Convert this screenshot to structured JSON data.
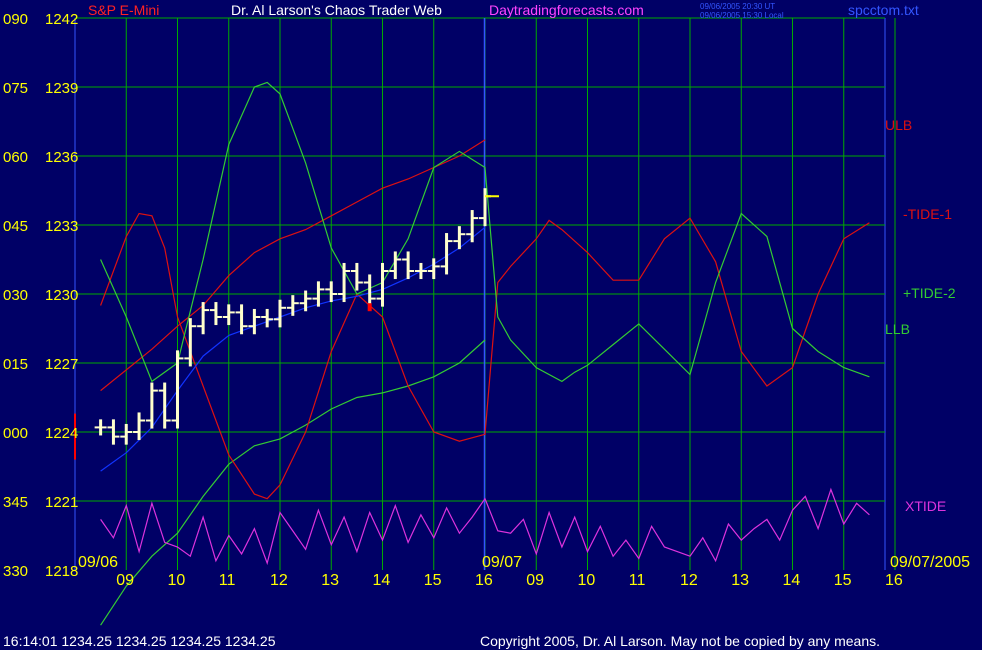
{
  "header": {
    "title_left": "S&P E-Mini",
    "title_center": "Dr. Al Larson's Chaos Trader Web",
    "site": "Daytradingforecasts.com",
    "timestamp_utc": "09/06/2005 20:30 UT",
    "timestamp_local": "09/06/2005 15:30 Local",
    "file_name": "spcctom.txt"
  },
  "footer": {
    "status": "16:14:01  1234.25 1234.25 1234.25 1234.25",
    "copyright": "Copyright 2005, Dr. Al Larson. May not be copied by any means."
  },
  "colors": {
    "background": "#000066",
    "grid": "#00aa00",
    "price_bars": "#ffffcc",
    "up_tick": "#ff0000",
    "ulb": "#dd1111",
    "llb": "#33cc33",
    "tide1": "#dd1111",
    "tide2": "#33cc33",
    "xtide": "#dd33dd",
    "mean": "#1133ff",
    "date_labels": "#ffff00",
    "hour_labels": "#ffff00",
    "osc_labels": "#ffff00",
    "price_labels": "#ffff00"
  },
  "chart_data": {
    "type": "line",
    "title": "Dr. Al Larson's Chaos Trader Web",
    "instrument": "S&P E-Mini",
    "date_labels": [
      "09/06",
      "09/07",
      "09/07/2005"
    ],
    "x_hours": [
      "09",
      "10",
      "11",
      "12",
      "13",
      "14",
      "15",
      "16",
      "09",
      "10",
      "11",
      "12",
      "13",
      "14",
      "15",
      "16"
    ],
    "y_price_ticks": [
      1218,
      1221,
      1224,
      1227,
      1230,
      1233,
      1236,
      1239,
      1242
    ],
    "y_price_labels": [
      "1218",
      "1221",
      "1224",
      "1227",
      "1230",
      "1233",
      "1236",
      "1239",
      "1242"
    ],
    "y_osc_labels": [
      "330",
      "345",
      "000",
      "015",
      "030",
      "045",
      "060",
      "075",
      "090"
    ],
    "ylim": [
      1218,
      1242
    ],
    "line_labels": [
      "ULB",
      "-TIDE-1",
      "+TIDE-2",
      "LLB",
      "XTIDE"
    ],
    "price_bars": {
      "name": "S&P E-Mini",
      "x": [
        8.5,
        8.75,
        9.0,
        9.25,
        9.5,
        9.75,
        10.0,
        10.25,
        10.5,
        10.75,
        11.0,
        11.25,
        11.5,
        11.75,
        12.0,
        12.25,
        12.5,
        12.75,
        13.0,
        13.25,
        13.5,
        13.75,
        14.0,
        14.25,
        14.5,
        14.75,
        15.0,
        15.25,
        15.5,
        15.75,
        16.0
      ],
      "close": [
        1224.2,
        1223.8,
        1224.0,
        1224.5,
        1225.8,
        1224.5,
        1227.2,
        1228.6,
        1229.3,
        1229.0,
        1229.2,
        1228.6,
        1229.0,
        1228.9,
        1229.4,
        1229.6,
        1229.8,
        1230.2,
        1230.0,
        1231.0,
        1230.5,
        1229.8,
        1231.0,
        1231.5,
        1231.0,
        1231.0,
        1231.2,
        1232.3,
        1232.6,
        1233.3,
        1234.25
      ],
      "last_price": 1234.25
    },
    "series": [
      {
        "name": "ULB",
        "x": [
          8.5,
          9.0,
          9.5,
          10.0,
          10.5,
          11.0,
          11.5,
          12.0,
          12.5,
          13.0,
          13.5,
          14.0,
          14.5,
          15.0,
          15.5,
          16.0
        ],
        "values": [
          1225.8,
          1226.7,
          1227.6,
          1228.6,
          1229.5,
          1230.8,
          1231.8,
          1232.4,
          1232.8,
          1233.4,
          1234.0,
          1234.6,
          1235.0,
          1235.5,
          1236.0,
          1236.7
        ]
      },
      {
        "name": "LLB",
        "x": [
          8.5,
          9.0,
          9.5,
          10.0,
          10.5,
          11.0,
          11.5,
          12.0,
          12.5,
          13.0,
          13.5,
          14.0,
          14.5,
          15.0,
          15.5,
          16.0
        ],
        "values": [
          1215.6,
          1217.3,
          1218.6,
          1219.6,
          1221.2,
          1222.6,
          1223.4,
          1223.7,
          1224.3,
          1225.0,
          1225.5,
          1225.7,
          1226.0,
          1226.4,
          1227.0,
          1228.0
        ]
      },
      {
        "name": "-TIDE-1",
        "x": [
          8.5,
          9.0,
          9.25,
          9.5,
          9.75,
          10.0,
          10.5,
          11.0,
          11.5,
          11.75,
          12.0,
          12.5,
          13.0,
          13.5,
          14.0,
          14.5,
          15.0,
          15.5,
          16.0,
          16.25,
          16.5,
          17.0,
          17.25,
          17.5,
          18.0,
          18.5,
          19.0,
          19.5,
          20.0,
          20.5,
          21.0,
          21.5,
          22.0,
          22.5,
          23.0,
          23.5
        ],
        "values": [
          1229.5,
          1232.5,
          1233.5,
          1233.4,
          1232.0,
          1229.0,
          1226.0,
          1223.0,
          1221.3,
          1221.1,
          1221.7,
          1224.0,
          1227.5,
          1230.0,
          1229.0,
          1226.0,
          1224.0,
          1223.6,
          1223.9,
          1230.5,
          1231.2,
          1232.4,
          1233.2,
          1232.8,
          1231.8,
          1230.6,
          1230.6,
          1232.4,
          1233.3,
          1231.4,
          1227.5,
          1226.0,
          1226.8,
          1230.0,
          1232.4,
          1233.1
        ]
      },
      {
        "name": "+TIDE-2",
        "x": [
          8.5,
          9.0,
          9.5,
          10.0,
          10.5,
          11.0,
          11.5,
          11.75,
          12.0,
          12.5,
          13.0,
          13.5,
          14.0,
          14.5,
          15.0,
          15.5,
          16.0,
          16.25,
          16.5,
          17.0,
          17.5,
          17.75,
          18.0,
          18.5,
          19.0,
          19.5,
          20.0,
          20.5,
          21.0,
          21.5,
          22.0,
          22.5,
          23.0,
          23.5
        ],
        "values": [
          1231.5,
          1229.0,
          1226.2,
          1227.0,
          1231.5,
          1236.5,
          1239.0,
          1239.2,
          1238.7,
          1235.7,
          1232.0,
          1230.0,
          1230.5,
          1232.4,
          1235.5,
          1236.2,
          1235.5,
          1229.0,
          1228.0,
          1226.8,
          1226.2,
          1226.6,
          1226.9,
          1227.8,
          1228.7,
          1227.6,
          1226.5,
          1230.5,
          1233.5,
          1232.5,
          1228.5,
          1227.5,
          1226.8,
          1226.4
        ]
      },
      {
        "name": "Mean",
        "x": [
          8.5,
          9.0,
          9.5,
          10.0,
          10.5,
          11.0,
          11.5,
          12.0,
          12.5,
          13.0,
          13.5,
          14.0,
          14.5,
          15.0,
          15.5,
          16.0
        ],
        "values": [
          1222.3,
          1223.1,
          1224.2,
          1225.8,
          1227.3,
          1228.2,
          1228.6,
          1229.0,
          1229.4,
          1229.7,
          1229.9,
          1230.2,
          1230.7,
          1231.3,
          1232.0,
          1232.9
        ]
      },
      {
        "name": "XTIDE",
        "x": [
          8.5,
          8.75,
          9.0,
          9.25,
          9.5,
          9.75,
          10.0,
          10.25,
          10.5,
          10.75,
          11.0,
          11.25,
          11.5,
          11.75,
          12.0,
          12.25,
          12.5,
          12.75,
          13.0,
          13.25,
          13.5,
          13.75,
          14.0,
          14.25,
          14.5,
          14.75,
          15.0,
          15.25,
          15.5,
          15.75,
          16.0,
          16.25,
          16.5,
          16.75,
          17.0,
          17.25,
          17.5,
          17.75,
          18.0,
          18.25,
          18.5,
          18.75,
          19.0,
          19.25,
          19.5,
          19.75,
          20.0,
          20.25,
          20.5,
          20.75,
          21.0,
          21.25,
          21.5,
          21.75,
          22.0,
          22.25,
          22.5,
          22.75,
          23.0,
          23.25,
          23.5
        ],
        "values": [
          1220.2,
          1219.4,
          1220.8,
          1218.8,
          1220.9,
          1219.2,
          1219.0,
          1218.6,
          1220.3,
          1218.4,
          1219.5,
          1218.7,
          1219.8,
          1218.3,
          1220.5,
          1219.7,
          1218.9,
          1220.6,
          1219.1,
          1220.3,
          1218.8,
          1220.5,
          1219.3,
          1220.8,
          1219.2,
          1220.4,
          1219.4,
          1220.7,
          1219.6,
          1220.3,
          1221.1,
          1219.7,
          1219.6,
          1220.2,
          1218.7,
          1220.5,
          1219.0,
          1220.3,
          1218.8,
          1219.9,
          1218.6,
          1219.3,
          1218.5,
          1219.9,
          1219.0,
          1218.8,
          1218.6,
          1219.4,
          1218.4,
          1220.0,
          1219.3,
          1219.8,
          1220.2,
          1219.3,
          1220.6,
          1221.2,
          1219.8,
          1221.5,
          1220.0,
          1220.9,
          1220.4
        ]
      }
    ],
    "grid": true,
    "session_divider_x": 16.0
  }
}
